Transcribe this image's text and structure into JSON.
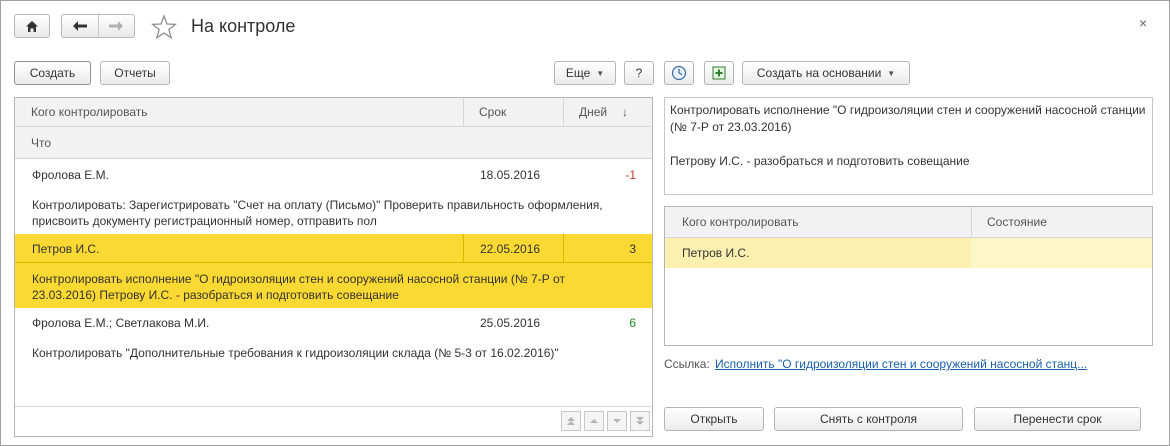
{
  "window": {
    "title": "На контроле",
    "close_glyph": "×"
  },
  "toolbar": {
    "create_label": "Создать",
    "reports_label": "Отчеты",
    "more_label": "Еще",
    "help_label": "?",
    "create_based_label": "Создать на основании"
  },
  "left_table": {
    "columns": {
      "who": "Кого контролировать",
      "deadline": "Срок",
      "days": "Дней",
      "sort_glyph": "↓",
      "what": "Что"
    },
    "rows": [
      {
        "who": "Фролова Е.М.",
        "date": "18.05.2016",
        "days": "-1",
        "desc": "Контролировать: Зарегистрировать \"Счет на оплату (Письмо)\" Проверить правильность оформления, присвоить документу регистрационный номер, отправить пол"
      },
      {
        "who": "Петров И.С.",
        "date": "22.05.2016",
        "days": "3",
        "desc": "Контролировать исполнение \"О гидроизоляции стен и сооружений насосной станции (№ 7-Р от 23.03.2016) Петрову И.С. - разобраться и подготовить совещание"
      },
      {
        "who": "Фролова Е.М.; Светлакова М.И.",
        "date": "25.05.2016",
        "days": "6",
        "desc": "Контролировать \"Дополнительные требования к гидроизоляции склада (№ 5-3 от 16.02.2016)\""
      }
    ]
  },
  "detail": {
    "note_line1": "Контролировать исполнение \"О гидроизоляции стен и сооружений насосной станции (№ 7-Р от 23.03.2016)",
    "note_line2": "Петрову И.С. - разобраться и подготовить совещание",
    "table": {
      "col_who": "Кого контролировать",
      "col_state": "Состояние",
      "rows": [
        {
          "who": "Петров И.С.",
          "state": ""
        }
      ]
    },
    "link_label": "Ссылка:",
    "link_text": "Исполнить \"О гидроизоляции стен и сооружений насосной станц..."
  },
  "actions": {
    "open_label": "Открыть",
    "remove_label": "Снять с контроля",
    "postpone_label": "Перенести срок"
  },
  "colors": {
    "selection": "#fad933",
    "negative": "#c0392b",
    "positive": "#1e8c1e",
    "link": "#1a5fab"
  }
}
